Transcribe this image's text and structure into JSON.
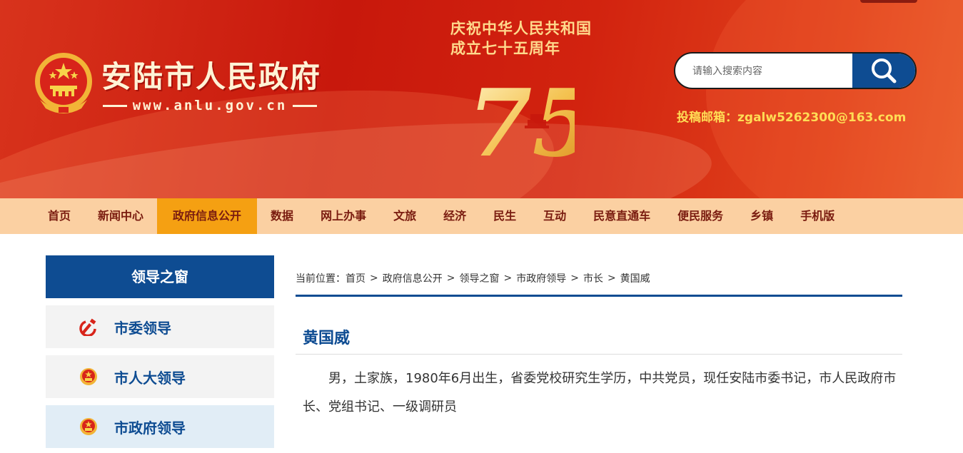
{
  "header": {
    "site_title": "安陆市人民政府",
    "site_url": "www.anlu.gov.cn",
    "celebrate_line1": "庆祝中华人民共和国",
    "celebrate_line2": "成立七十五周年",
    "anniversary_number": "75",
    "search_placeholder": "请输入搜索内容",
    "contact": "投稿邮箱：zgalw5262300@163.com"
  },
  "nav": {
    "items": [
      "首页",
      "新闻中心",
      "政府信息公开",
      "数据",
      "网上办事",
      "文旅",
      "经济",
      "民生",
      "互动",
      "民意直通车",
      "便民服务",
      "乡镇",
      "手机版"
    ],
    "active_index": 2
  },
  "sidebar": {
    "title": "领导之窗",
    "items": [
      {
        "label": "市委领导",
        "icon": "party-emblem-icon"
      },
      {
        "label": "市人大领导",
        "icon": "national-emblem-icon"
      },
      {
        "label": "市政府领导",
        "icon": "national-emblem-icon"
      }
    ],
    "active_index": 2
  },
  "breadcrumb": {
    "prefix": "当前位置：",
    "items": [
      "首页",
      "政府信息公开",
      "领导之窗",
      "市政府领导",
      "市长",
      "黄国威"
    ]
  },
  "article": {
    "title": "黄国威",
    "body": "男，土家族，1980年6月出生，省委党校研究生学历，中共党员，现任安陆市委书记，市人民政府市长、党组书记、一级调研员"
  },
  "colors": {
    "banner_red": "#c8180c",
    "nav_bg": "#fbd0a2",
    "nav_active": "#f5a012",
    "primary_blue": "#0e4c92"
  }
}
